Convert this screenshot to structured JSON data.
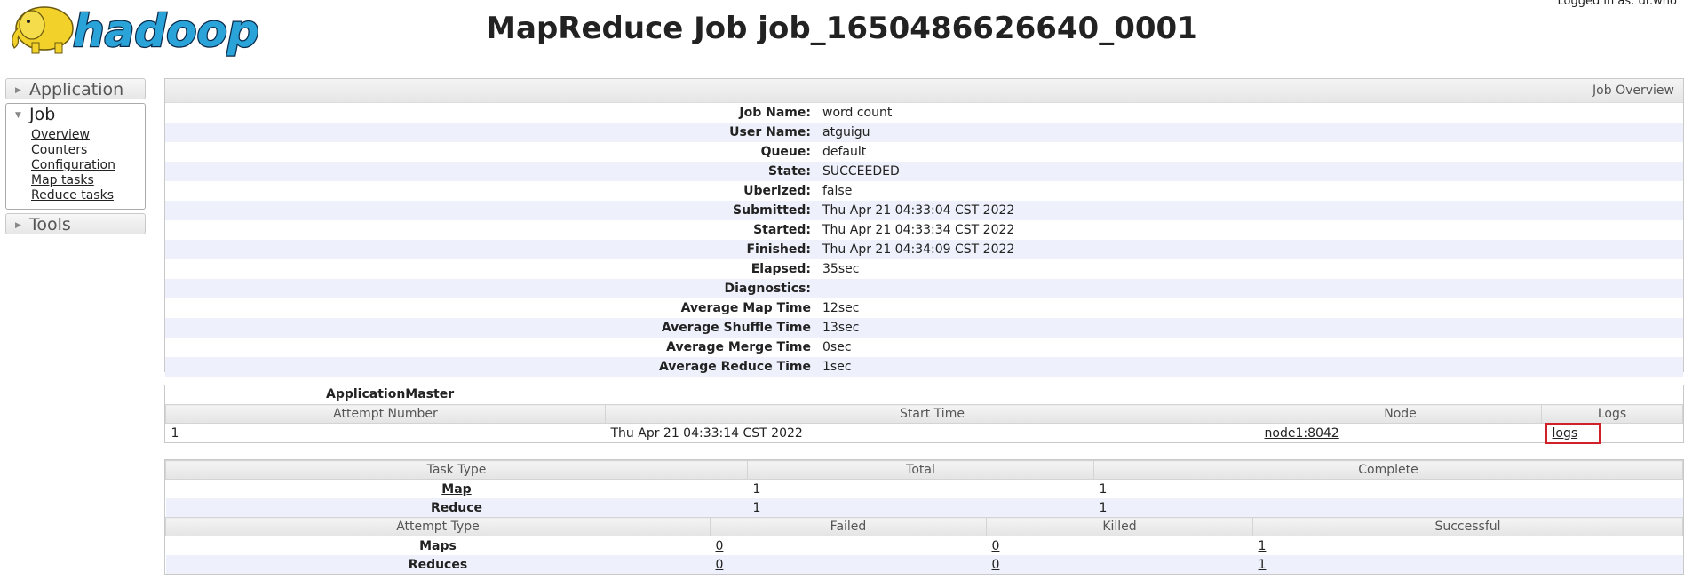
{
  "header": {
    "logo_text": "hadoop",
    "title": "MapReduce Job job_1650486626640_0001",
    "logged_in": "Logged in as: dr.who"
  },
  "sidebar": {
    "application": "Application",
    "job": "Job",
    "job_links": [
      "Overview",
      "Counters",
      "Configuration",
      "Map tasks",
      "Reduce tasks"
    ],
    "tools": "Tools"
  },
  "overview": {
    "heading": "Job Overview",
    "rows": [
      {
        "label": "Job Name:",
        "value": "word count"
      },
      {
        "label": "User Name:",
        "value": "atguigu"
      },
      {
        "label": "Queue:",
        "value": "default"
      },
      {
        "label": "State:",
        "value": "SUCCEEDED"
      },
      {
        "label": "Uberized:",
        "value": "false"
      },
      {
        "label": "Submitted:",
        "value": "Thu Apr 21 04:33:04 CST 2022"
      },
      {
        "label": "Started:",
        "value": "Thu Apr 21 04:33:34 CST 2022"
      },
      {
        "label": "Finished:",
        "value": "Thu Apr 21 04:34:09 CST 2022"
      },
      {
        "label": "Elapsed:",
        "value": "35sec"
      },
      {
        "label": "Diagnostics:",
        "value": ""
      },
      {
        "label": "Average Map Time",
        "value": "12sec"
      },
      {
        "label": "Average Shuffle Time",
        "value": "13sec"
      },
      {
        "label": "Average Merge Time",
        "value": "0sec"
      },
      {
        "label": "Average Reduce Time",
        "value": "1sec"
      }
    ]
  },
  "am": {
    "caption": "ApplicationMaster",
    "headers": [
      "Attempt Number",
      "Start Time",
      "Node",
      "Logs"
    ],
    "row": {
      "attempt": "1",
      "start": "Thu Apr 21 04:33:14 CST 2022",
      "node": "node1:8042",
      "logs": "logs"
    }
  },
  "tasks": {
    "headers": [
      "Task Type",
      "Total",
      "Complete"
    ],
    "rows": [
      {
        "type": "Map",
        "total": "1",
        "complete": "1"
      },
      {
        "type": "Reduce",
        "total": "1",
        "complete": "1"
      }
    ],
    "attempt_headers": [
      "Attempt Type",
      "Failed",
      "Killed",
      "Successful"
    ],
    "attempt_rows": [
      {
        "type": "Maps",
        "failed": "0",
        "killed": "0",
        "successful": "1"
      },
      {
        "type": "Reduces",
        "failed": "0",
        "killed": "0",
        "successful": "1"
      }
    ]
  },
  "colors": {
    "highlight": "#d0202a",
    "logo_blue": "#2aa3d8",
    "elephant": "#f2d12a"
  }
}
